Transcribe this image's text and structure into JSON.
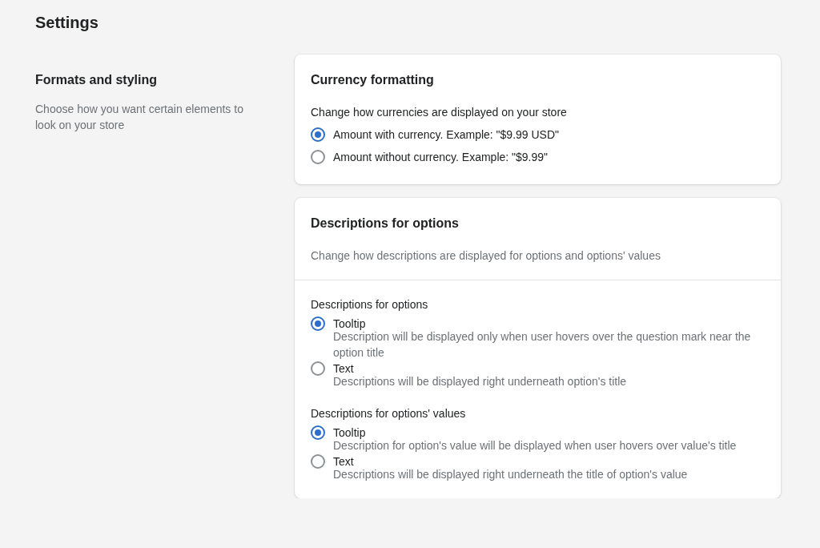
{
  "page_title": "Settings",
  "section": {
    "title": "Formats and styling",
    "description": "Choose how you want certain elements to look on your store"
  },
  "cards": [
    {
      "title": "Currency formatting",
      "groups": [
        {
          "label": "Change how currencies are displayed on your store",
          "options": [
            {
              "label": "Amount with currency. Example: \"$9.99 USD\"",
              "selected": true
            },
            {
              "label": "Amount without currency. Example: \"$9.99\"",
              "selected": false
            }
          ]
        }
      ]
    },
    {
      "title": "Descriptions for options",
      "subtitle": "Change how descriptions are displayed for options and options' values",
      "groups": [
        {
          "label": "Descriptions for options",
          "options": [
            {
              "label": "Tooltip",
              "description": "Description will be displayed only when user hovers over the question mark near the option title",
              "selected": true
            },
            {
              "label": "Text",
              "description": "Descriptions will be displayed right underneath option's title",
              "selected": false
            }
          ]
        },
        {
          "label": "Descriptions for options' values",
          "options": [
            {
              "label": "Tooltip",
              "description": "Description for option's value will be displayed when user hovers over value's title",
              "selected": true
            },
            {
              "label": "Text",
              "description": "Descriptions will be displayed right underneath the title of option's value",
              "selected": false
            }
          ]
        }
      ]
    }
  ]
}
